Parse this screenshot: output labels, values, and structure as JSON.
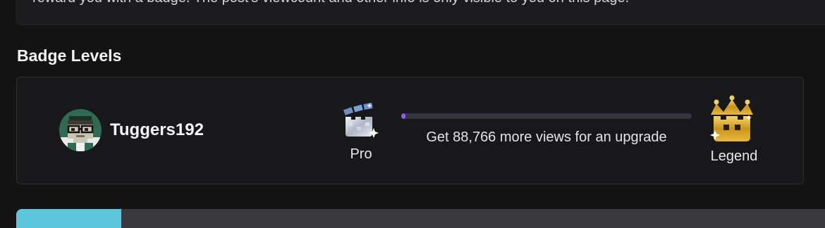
{
  "info": {
    "text": "reward you with a badge. The post's viewcount and other info is only visible to you on this page."
  },
  "section": {
    "title": "Badge Levels"
  },
  "user": {
    "name": "Tuggers192"
  },
  "current_badge": {
    "label": "Pro",
    "icon": "pro-badge-icon"
  },
  "progress": {
    "text": "Get 88,766 more views for an upgrade",
    "fraction": 0.015,
    "color": "#8b5cf6"
  },
  "next_badge": {
    "label": "Legend",
    "icon": "legend-crown-icon"
  },
  "colors": {
    "background": "#131314",
    "card": "#18181a",
    "accent": "#5cc6dc"
  }
}
